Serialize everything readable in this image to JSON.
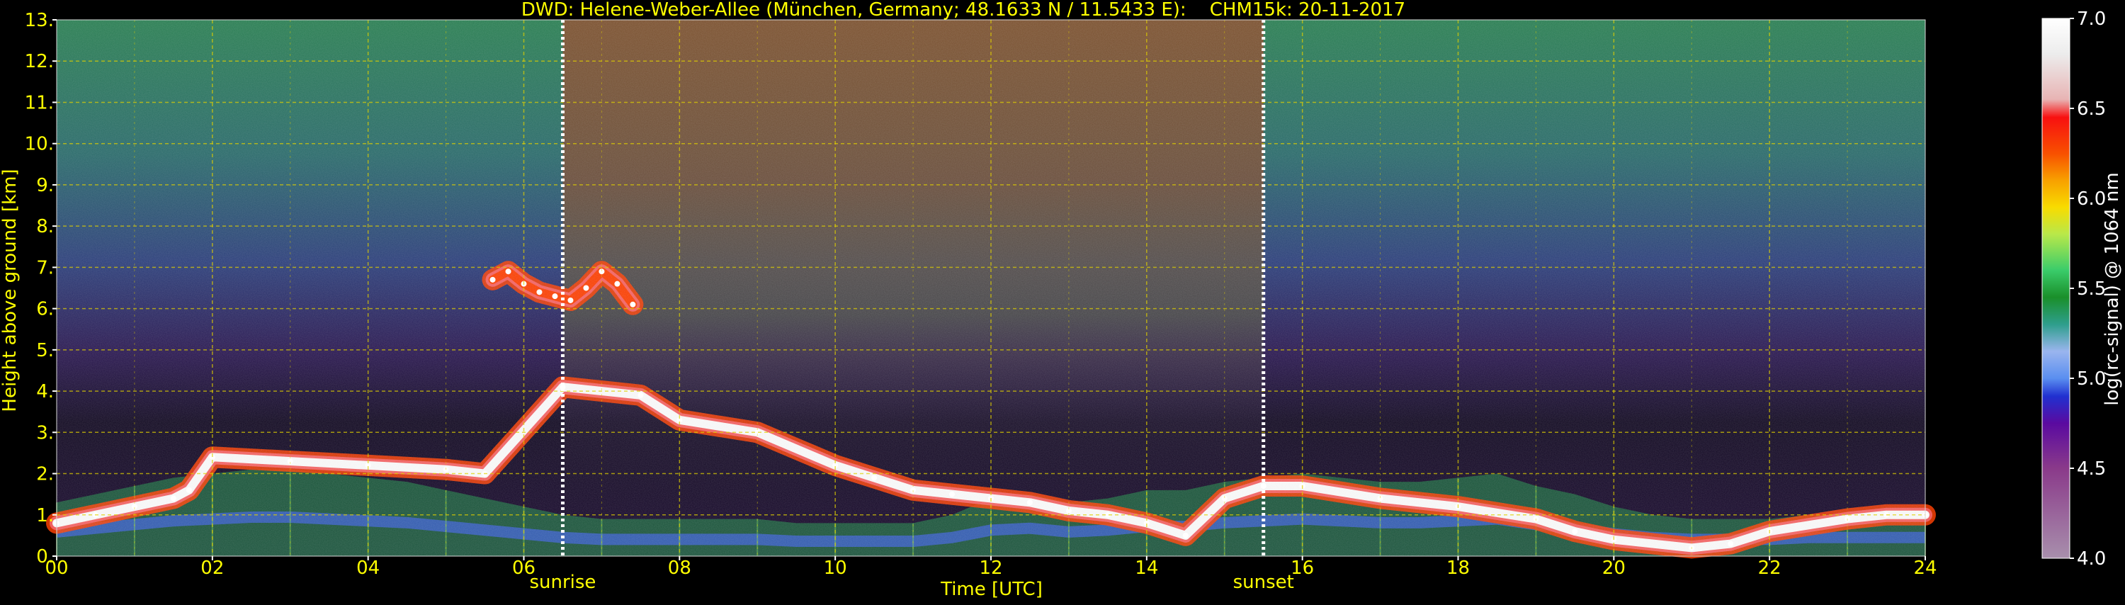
{
  "chart_data": {
    "type": "heatmap",
    "title": "DWD: Helene-Weber-Allee (München, Germany; 48.1633 N / 11.5433 E):    CHM15k: 20-11-2017",
    "xlabel": "Time [UTC]",
    "ylabel": "Height above ground [km]",
    "colorbar_label": "log(rc-signal) @ 1064 nm",
    "xlim": [
      0,
      24
    ],
    "ylim": [
      0,
      13
    ],
    "clim": [
      4.0,
      7.0
    ],
    "grid": true,
    "x_ticks": [
      0,
      2,
      4,
      6,
      8,
      10,
      12,
      14,
      16,
      18,
      20,
      22,
      24
    ],
    "x_tick_labels": [
      "00",
      "02",
      "04",
      "06",
      "08",
      "10",
      "12",
      "14",
      "16",
      "18",
      "20",
      "22",
      "24"
    ],
    "y_ticks": [
      0,
      1,
      2,
      3,
      4,
      5,
      6,
      7,
      8,
      9,
      10,
      11,
      12,
      13
    ],
    "y_tick_labels": [
      "0.",
      "1.",
      "2.",
      "3.",
      "4.",
      "5.",
      "6.",
      "7.",
      "8.",
      "9.",
      "10.",
      "11.",
      "12.",
      "13."
    ],
    "colorbar_ticks": [
      4.0,
      4.5,
      5.0,
      5.5,
      6.0,
      6.5,
      7.0
    ],
    "colorbar_tick_labels": [
      "4.0",
      "4.5",
      "5.0",
      "5.5",
      "6.0",
      "6.5",
      "7.0"
    ],
    "annotations": [
      {
        "label": "sunrise",
        "x": 6.5
      },
      {
        "label": "sunset",
        "x": 15.5
      }
    ],
    "colormap": [
      {
        "value": 4.0,
        "color": "#a88fac"
      },
      {
        "value": 4.5,
        "color": "#8a3a8a"
      },
      {
        "value": 4.75,
        "color": "#5a0aa0"
      },
      {
        "value": 4.9,
        "color": "#2030d0"
      },
      {
        "value": 5.0,
        "color": "#5a8ff0"
      },
      {
        "value": 5.15,
        "color": "#9ab5ee"
      },
      {
        "value": 5.3,
        "color": "#2e9e8c"
      },
      {
        "value": 5.45,
        "color": "#1a8f2a"
      },
      {
        "value": 5.6,
        "color": "#3acc6a"
      },
      {
        "value": 5.8,
        "color": "#b8e84a"
      },
      {
        "value": 5.95,
        "color": "#f8dc00"
      },
      {
        "value": 6.1,
        "color": "#f8a000"
      },
      {
        "value": 6.25,
        "color": "#f85000"
      },
      {
        "value": 6.45,
        "color": "#f81010"
      },
      {
        "value": 6.55,
        "color": "#e8b4b4"
      },
      {
        "value": 6.8,
        "color": "#ececec"
      },
      {
        "value": 7.0,
        "color": "#ffffff"
      }
    ],
    "layers": [
      {
        "name": "boundary layer aerosol",
        "x": [
          0,
          0.5,
          1,
          1.5,
          2,
          2.5,
          3,
          3.5,
          4,
          4.5,
          5,
          5.5,
          6,
          6.5,
          7,
          7.5,
          8,
          8.5,
          9,
          9.5,
          10,
          10.5,
          11,
          11.5,
          12,
          12.5,
          13,
          13.5,
          14,
          14.5,
          15,
          15.5,
          16,
          16.5,
          17,
          17.5,
          18,
          18.5,
          19,
          19.5,
          20,
          20.5,
          21,
          21.5,
          22,
          22.5,
          23,
          23.5,
          24
        ],
        "y_top": [
          1.3,
          1.5,
          1.7,
          1.9,
          2.0,
          2.1,
          2.1,
          2.0,
          1.9,
          1.8,
          1.6,
          1.4,
          1.2,
          1.0,
          0.9,
          0.9,
          0.9,
          0.9,
          0.9,
          0.8,
          0.8,
          0.8,
          0.8,
          1.0,
          1.4,
          1.5,
          1.3,
          1.4,
          1.6,
          1.6,
          1.8,
          1.9,
          2.0,
          1.9,
          1.8,
          1.8,
          1.9,
          2.0,
          1.7,
          1.5,
          1.2,
          1.0,
          0.9,
          0.9,
          0.9,
          1.0,
          1.0,
          1.0,
          1.0
        ],
        "value": 5.4
      },
      {
        "name": "cloud layer",
        "x": [
          0.0,
          0.5,
          1.0,
          1.5,
          1.7,
          2.0,
          3.0,
          4.0,
          5.0,
          5.5,
          6.5,
          7.5,
          8.0,
          9.0,
          10.0,
          10.5,
          11.0,
          11.5,
          12.0,
          12.5,
          13.0,
          13.5,
          14.0,
          14.5,
          15.0,
          15.5,
          16.0,
          17.0,
          18.0,
          19.0,
          19.5,
          20.0,
          21.0,
          21.5,
          22.0,
          23.0,
          23.5,
          24.0
        ],
        "y": [
          0.8,
          1.0,
          1.2,
          1.4,
          1.6,
          2.4,
          2.3,
          2.2,
          2.1,
          2.0,
          4.1,
          3.9,
          3.3,
          3.0,
          2.2,
          1.9,
          1.6,
          1.5,
          1.4,
          1.3,
          1.1,
          1.0,
          0.8,
          0.5,
          1.4,
          1.7,
          1.7,
          1.4,
          1.2,
          0.9,
          0.6,
          0.4,
          0.2,
          0.3,
          0.6,
          0.9,
          1.0,
          1.0
        ],
        "value": 6.9
      },
      {
        "name": "elevated cloud",
        "x": [
          5.6,
          5.8,
          6.0,
          6.2,
          6.4,
          6.6,
          6.8,
          7.0,
          7.2,
          7.4
        ],
        "y": [
          6.7,
          6.9,
          6.6,
          6.4,
          6.3,
          6.2,
          6.5,
          6.9,
          6.6,
          6.1
        ],
        "value": 6.3
      }
    ]
  }
}
